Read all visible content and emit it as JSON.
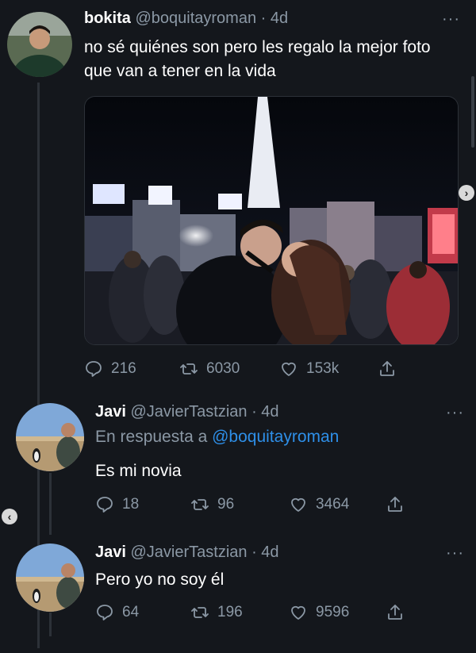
{
  "tweets": [
    {
      "name": "bokita",
      "handle": "@boquitayroman",
      "time": "· 4d",
      "text": "no sé quiénes son pero les regalo la mejor foto que van a tener en la vida",
      "replies": "216",
      "retweets": "6030",
      "likes": "153k",
      "has_media": true
    },
    {
      "name": "Javi",
      "handle": "@JavierTastzian",
      "time": "· 4d",
      "reply_prefix": "En respuesta a",
      "reply_mention": "@boquitayroman",
      "text": "Es mi novia",
      "replies": "18",
      "retweets": "96",
      "likes": "3464"
    },
    {
      "name": "Javi",
      "handle": "@JavierTastzian",
      "time": "· 4d",
      "text": "Pero yo no soy él",
      "replies": "64",
      "retweets": "196",
      "likes": "9596"
    }
  ],
  "icons": {
    "more": "more-dots-icon",
    "reply": "reply-icon",
    "retweet": "retweet-icon",
    "like": "heart-icon",
    "share": "share-icon"
  },
  "colors": {
    "background": "#14171c",
    "secondary_text": "#8b98a5",
    "mention": "#2e8fe8"
  }
}
